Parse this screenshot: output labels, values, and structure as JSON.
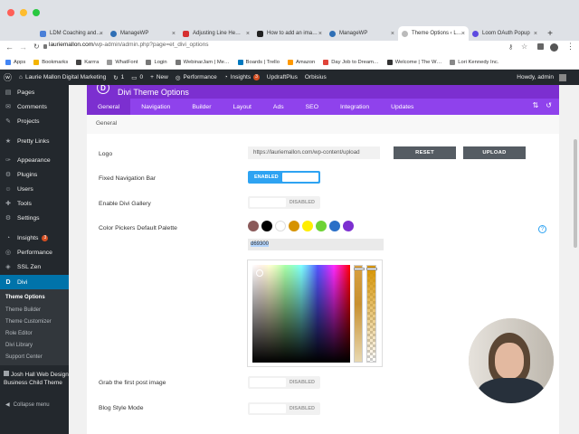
{
  "browser": {
    "tabs": [
      {
        "title": "LDM Coaching and…",
        "color": "#4a7fd8"
      },
      {
        "title": "ManageWP",
        "color": "#2f6fb5"
      },
      {
        "title": "Adjusting Line He…",
        "color": "#d63030"
      },
      {
        "title": "How to add an ima…",
        "color": "#222222"
      },
      {
        "title": "ManageWP",
        "color": "#2f6fb5"
      },
      {
        "title": "Theme Options ‹ L…",
        "color": "#bbbbbb"
      },
      {
        "title": "Loom OAuth Popup",
        "color": "#5c4ae0"
      }
    ],
    "new_tab": "+",
    "url_host": "lauriemallon.com",
    "url_path": "/wp-admin/admin.php?page=et_divi_options",
    "bookmarks": [
      {
        "label": "Apps",
        "color": "#4285f4"
      },
      {
        "label": "Bookmarks",
        "color": "#f4b400"
      },
      {
        "label": "Karrra",
        "color": "#444444"
      },
      {
        "label": "WhatFont",
        "color": "#999999"
      },
      {
        "label": "Login",
        "color": "#777777"
      },
      {
        "label": "WebinarJam | Me…",
        "color": "#777777"
      },
      {
        "label": "Boards | Trello",
        "color": "#0079bf"
      },
      {
        "label": "Amazon",
        "color": "#ff9900"
      },
      {
        "label": "Day Job to Dream…",
        "color": "#e0443a"
      },
      {
        "label": "Welcome | The W…",
        "color": "#333333"
      },
      {
        "label": "Lori Kennedy Inc.",
        "color": "#888888"
      }
    ]
  },
  "adminbar": {
    "site_name": "Laurie Mallon Digital Marketing",
    "updates_count": "1",
    "comments_count": "0",
    "new_label": "New",
    "performance_label": "Performance",
    "insights_label": "Insights",
    "insights_count": "3",
    "updraft_label": "UpdraftPlus",
    "orbisius_label": "Orbisius",
    "howdy": "Howdy, admin"
  },
  "sidebar": {
    "items": [
      {
        "label": "Pages",
        "icon": "▤"
      },
      {
        "label": "Comments",
        "icon": "✉"
      },
      {
        "label": "Projects",
        "icon": "✎"
      },
      {
        "label": "Pretty Links",
        "icon": "★"
      },
      {
        "label": "Appearance",
        "icon": "✑"
      },
      {
        "label": "Plugins",
        "icon": "⚙"
      },
      {
        "label": "Users",
        "icon": "☺"
      },
      {
        "label": "Tools",
        "icon": "✚"
      },
      {
        "label": "Settings",
        "icon": "⚙"
      },
      {
        "label": "Insights",
        "icon": "◔",
        "badge": "3"
      },
      {
        "label": "Performance",
        "icon": "◎"
      },
      {
        "label": "SSL Zen",
        "icon": "◈"
      },
      {
        "label": "Divi",
        "icon": "D"
      }
    ],
    "submenu": [
      "Theme Options",
      "Theme Builder",
      "Theme Customizer",
      "Role Editor",
      "Divi Library",
      "Support Center"
    ],
    "extra_item": "Josh Hall Web Design Business Child Theme",
    "collapse_label": "Collapse menu"
  },
  "panel": {
    "title": "Divi Theme Options",
    "logo_letter": "D",
    "tabs": [
      "General",
      "Navigation",
      "Builder",
      "Layout",
      "Ads",
      "SEO",
      "Integration",
      "Updates"
    ],
    "subtab": "General"
  },
  "settings": {
    "logo_label": "Logo",
    "logo_value": "https://lauriemallon.com/wp-content/upload",
    "reset_label": "RESET",
    "upload_label": "UPLOAD",
    "fixed_nav_label": "Fixed Navigation Bar",
    "fixed_nav_state": "ENABLED",
    "gallery_label": "Enable Divi Gallery",
    "gallery_state": "DISABLED",
    "palette_label": "Color Pickers Default Palette",
    "palette_colors": [
      "#8b5a5a",
      "#000000",
      "#ffffff",
      "#d69300",
      "#ffee00",
      "#6ed335",
      "#2a6fc7",
      "#7c2fd0"
    ],
    "hex_value": "d69300",
    "help_icon": "?",
    "grab_label": "Grab the first post image",
    "grab_state": "DISABLED",
    "blog_label": "Blog Style Mode",
    "blog_state": "DISABLED"
  }
}
